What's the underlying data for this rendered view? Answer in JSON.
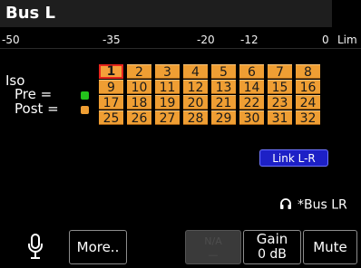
{
  "title": "Bus L",
  "scale": [
    "-50",
    "-35",
    "-20",
    "-12",
    "0",
    "Lim"
  ],
  "legend": {
    "iso": "Iso",
    "pre": "Pre =",
    "post": "Post ="
  },
  "colors": {
    "pre": "#23c41b",
    "post": "#ef9e33",
    "channel": "#ef9e33",
    "selected_border": "#e8261c",
    "link": "#1d20c6"
  },
  "channels": [
    "1",
    "2",
    "3",
    "4",
    "5",
    "6",
    "7",
    "8",
    "9",
    "10",
    "11",
    "12",
    "13",
    "14",
    "15",
    "16",
    "17",
    "18",
    "19",
    "20",
    "21",
    "22",
    "23",
    "24",
    "25",
    "26",
    "27",
    "28",
    "29",
    "30",
    "31",
    "32"
  ],
  "selected_channel": "1",
  "link_button": "Link L-R",
  "headphone": {
    "icon": "headphone-icon",
    "label": "*Bus LR"
  },
  "bottom": {
    "mic_icon": "microphone-icon",
    "more": "More..",
    "disabled_line1": "N/A",
    "disabled_line2": "—",
    "gain_label": "Gain",
    "gain_value": "0 dB",
    "mute": "Mute"
  }
}
